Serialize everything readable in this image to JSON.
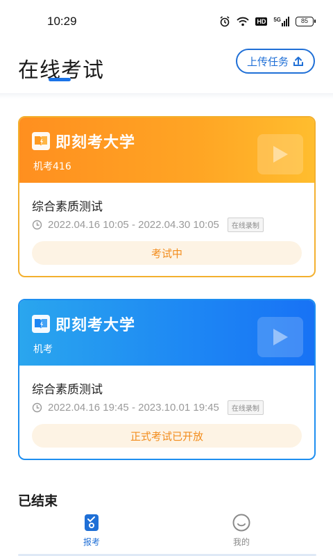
{
  "status_bar": {
    "time": "10:29",
    "hd": "HD",
    "signal_label": "5G",
    "battery": "85",
    "icons": [
      "alarm-icon",
      "wifi-icon",
      "hd-icon",
      "signal-icon",
      "battery-icon"
    ]
  },
  "header": {
    "title": "在线考试",
    "upload_button": "上传任务",
    "upload_icon": "upload-icon"
  },
  "exams": [
    {
      "university": "即刻考大学",
      "code": "机考416",
      "name": "综合素质测试",
      "time_range": "2022.04.16 10:05 - 2022.04.30 10:05",
      "badge": "在线录制",
      "status": "考试中",
      "theme": "#ff9a22"
    },
    {
      "university": "即刻考大学",
      "code": "机考",
      "name": "综合素质测试",
      "time_range": "2022.04.16 19:45 - 2023.10.01 19:45",
      "badge": "在线录制",
      "status": "正式考试已开放",
      "theme": "#1d86f4"
    }
  ],
  "sections": {
    "ended": "已结束"
  },
  "nav": {
    "exams_label": "报考",
    "mine_label": "我的",
    "active": "报考",
    "accent": "#1f6fd6"
  }
}
